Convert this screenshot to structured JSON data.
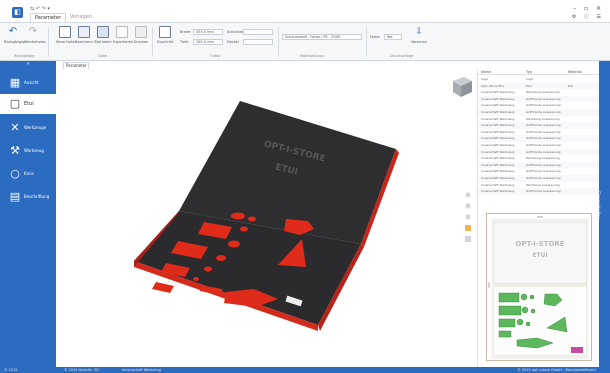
{
  "titlebar": {
    "app_icon": "app-logo-icon",
    "quick_access": "⇆ ↶ ↷ ▾",
    "tabs": [
      "Parameter",
      "Vorlagen"
    ],
    "window_controls": "– ▫ ✕",
    "aux_controls": "⚙ ⓘ ☰"
  },
  "ribbon": {
    "buttons": [
      {
        "label": "Rückgängig",
        "icon": "undo-icon"
      },
      {
        "label": "Wiederholen",
        "icon": "redo-icon"
      },
      {
        "label": "Neue Datei",
        "icon": "new-file-icon"
      },
      {
        "label": "Speichern",
        "icon": "save-icon"
      },
      {
        "label": "Bild laden",
        "icon": "load-image-icon"
      },
      {
        "label": "Exportieren",
        "icon": "export-icon"
      },
      {
        "label": "Drucken",
        "icon": "print-icon"
      },
      {
        "label": "Zuschnitt",
        "icon": "cut-icon"
      }
    ],
    "groups": [
      "Rückgängig",
      "Datei",
      "Größe",
      "Material/Logo",
      "Druckvorlage"
    ],
    "fields": [
      {
        "label": "Breite",
        "value": "355.0 mm"
      },
      {
        "label": "Tiefe",
        "value": "265.0 mm"
      },
      {
        "label": "Schichtdicke",
        "value": ""
      },
      {
        "label": "Deckel",
        "value": ""
      },
      {
        "label": "Schaumstoff",
        "value": "Schaumstoff - Farbe / PE - 2000"
      },
      {
        "label": "Farbe",
        "value": "Rot"
      }
    ],
    "side_button": "Vorschau"
  },
  "sidebar": {
    "collapse": "«",
    "items": [
      {
        "label": "Ansicht",
        "icon": "grid-view-icon",
        "active": false
      },
      {
        "label": "Etui",
        "icon": "case-outline-icon",
        "active": true
      },
      {
        "label": "Werkzeuge",
        "icon": "tools-icon",
        "active": false
      },
      {
        "label": "Werkzeug",
        "icon": "wrench-icon",
        "active": false
      },
      {
        "label": "Kreis",
        "icon": "circle-icon",
        "active": false
      },
      {
        "label": "Beschriftung",
        "icon": "label-doc-icon",
        "active": false
      }
    ]
  },
  "document_tab": "Parameter",
  "viewport": {
    "lid_text_line1": "OPT-I-STORE",
    "lid_text_line2": "ETUI",
    "nav_cube": "nav-cube-icon",
    "tools": [
      "zoom-icon",
      "pan-icon",
      "rotate-icon",
      "color-icon",
      "grid-icon"
    ]
  },
  "table": {
    "headers": [
      "Name",
      "Typ",
      "Material"
    ],
    "rows": [
      [
        "Logo",
        "Logo",
        ""
      ],
      [
        "Opt-i-Store Etui",
        "Etui",
        "Rot"
      ],
      [
        "Innenschaft Werkzeug",
        "Werkzeug Aussparung",
        ""
      ],
      [
        "Innenschaft Werkzeug",
        "Griffmulde Aussparung",
        ""
      ],
      [
        "Innenschaft Werkzeug",
        "Griffmulde Aussparung",
        ""
      ],
      [
        "Innenschaft Werkzeug",
        "Griffmulde Aussparung",
        ""
      ],
      [
        "Innenschaft Werkzeug",
        "Werkzeug Aussparung",
        ""
      ],
      [
        "Innenschaft Werkzeug",
        "Griffmulde Aussparung",
        ""
      ],
      [
        "Innenschaft Werkzeug",
        "Griffmulde Aussparung",
        ""
      ],
      [
        "Innenschaft Werkzeug",
        "Griffmulde Aussparung",
        ""
      ],
      [
        "Innenschaft Werkzeug",
        "Griffmulde Aussparung",
        ""
      ],
      [
        "Innenschaft Werkzeug",
        "Griffmulde Aussparung",
        ""
      ],
      [
        "Innenschaft Werkzeug",
        "Werkzeug Aussparung",
        ""
      ],
      [
        "Innenschaft Werkzeug",
        "Griffmulde Aussparung",
        ""
      ],
      [
        "Innenschaft Werkzeug",
        "Griffmulde Aussparung",
        ""
      ],
      [
        "Innenschaft Werkzeug",
        "Griffmulde Aussparung",
        ""
      ],
      [
        "Innenschaft Werkzeug",
        "Werkzeug Aussparung",
        ""
      ],
      [
        "Innenschaft Werkzeug",
        "Griffmulde Aussparung",
        ""
      ]
    ]
  },
  "preview": {
    "top_dim": "355",
    "side_dim": "265",
    "line1": "OPT-I-STORE",
    "line2": "ETUI"
  },
  "right_strip_label": "Eigenschaften",
  "status": {
    "left": "© 2015",
    "mid1": "© 2015 Ansicht: 3D",
    "mid2": "Innenschaft Werkzeug",
    "right": "© 2015 opt-i-store GmbH - Benutzerdefiniert"
  },
  "colors": {
    "accent": "#2b6cc0",
    "foam_top": "#2d2d30",
    "foam_side": "#d42a1c",
    "cutout": "#e02a1a",
    "preview_green": "#5cb85c"
  }
}
